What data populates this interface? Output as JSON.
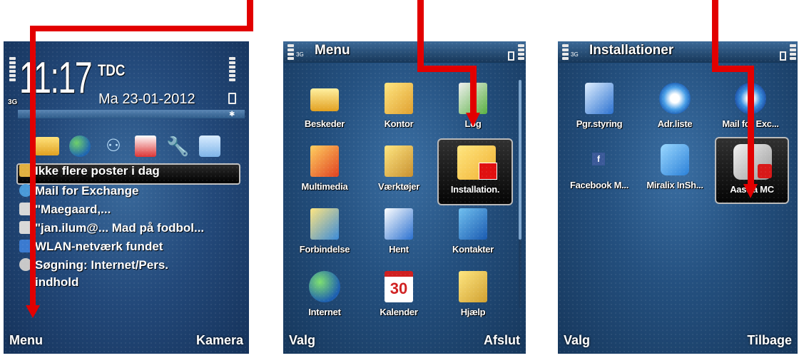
{
  "phone1": {
    "time": "11:17",
    "network": "TDC",
    "date": "Ma 23-01-2012",
    "net_type": "3G",
    "notifications": [
      {
        "text": "Ikke flere poster i dag",
        "icon": "calendar-icon",
        "color": "#e0b040"
      },
      {
        "text": "Mail for Exchange",
        "icon": "cloud-mail-icon",
        "color": "#4a9ad8"
      },
      {
        "text": "\"Maegaard,...",
        "icon": "envelope-icon",
        "color": "#d8d8d8"
      },
      {
        "text": "\"jan.ilum@...  Mad på fodbol...",
        "icon": "envelope-icon",
        "color": "#d8d8d8"
      },
      {
        "text": "WLAN-netværk fundet",
        "icon": "wlan-icon",
        "color": "#3a7ad0"
      },
      {
        "text": "Søgning: Internet/Pers.",
        "icon": "search-icon",
        "color": "#c8c8c8"
      }
    ],
    "notification_extra": "indhold",
    "softkey_left": "Menu",
    "softkey_right": "Kamera"
  },
  "phone2": {
    "title": "Menu",
    "net_type": "3G",
    "items": [
      {
        "label": "Beskeder",
        "icon": "envelope-icon"
      },
      {
        "label": "Kontor",
        "icon": "folder-pencil-icon"
      },
      {
        "label": "Log",
        "icon": "log-icon"
      },
      {
        "label": "Multimedia",
        "icon": "folder-media-icon"
      },
      {
        "label": "Værktøjer",
        "icon": "folder-tools-icon"
      },
      {
        "label": "Installation.",
        "icon": "folder-install-icon"
      },
      {
        "label": "Forbindelse",
        "icon": "folder-connect-icon"
      },
      {
        "label": "Hent",
        "icon": "download-icon"
      },
      {
        "label": "Kontakter",
        "icon": "contacts-icon"
      },
      {
        "label": "Internet",
        "icon": "globe-icon"
      },
      {
        "label": "Kalender",
        "icon": "calendar-icon"
      },
      {
        "label": "Hjælp",
        "icon": "help-icon"
      }
    ],
    "calendar_day": "30",
    "softkey_left": "Valg",
    "softkey_right": "Afslut"
  },
  "phone3": {
    "title": "Installationer",
    "net_type": "3G",
    "items": [
      {
        "label": "Pgr.styring",
        "icon": "app-manager-icon"
      },
      {
        "label": "Adr.liste",
        "icon": "address-sync-icon"
      },
      {
        "label": "Mail for Exc...",
        "icon": "mail-exchange-icon"
      },
      {
        "label": "Facebook M...",
        "icon": "facebook-icon"
      },
      {
        "label": "Miralix InSh...",
        "icon": "puzzle-icon"
      },
      {
        "label": "Aastra MC",
        "icon": "aastra-icon"
      }
    ],
    "softkey_left": "Valg",
    "softkey_right": "Tilbage"
  },
  "colors": {
    "arrow": "#e20000",
    "screen": "#24507f",
    "selection": "#050505"
  }
}
